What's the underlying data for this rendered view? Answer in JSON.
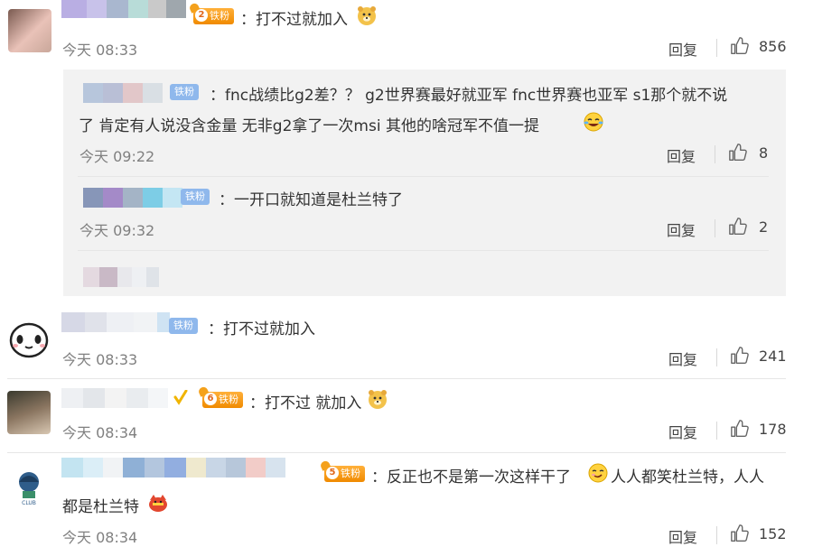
{
  "comments": [
    {
      "text": "：打不过就加入",
      "time": "今天 08:33",
      "reply_label": "回复",
      "likes": "856",
      "badge": {
        "level": "2",
        "label": "铁粉"
      }
    },
    {
      "text": "：打不过就加入",
      "time": "今天 08:33",
      "reply_label": "回复",
      "likes": "241",
      "badge": {
        "label": "铁粉"
      }
    },
    {
      "text": "：打不过 就加入",
      "time": "今天 08:34",
      "reply_label": "回复",
      "likes": "178",
      "badge": {
        "level": "6",
        "label": "铁粉"
      }
    },
    {
      "text_line1": "：反正也不是第一次这样干了",
      "text_line1b": "人人都笑杜兰特，人人",
      "text_line2": "都是杜兰特",
      "time": "今天 08:34",
      "reply_label": "回复",
      "likes": "152",
      "badge": {
        "level": "5",
        "label": "铁粉"
      }
    }
  ],
  "replies": [
    {
      "line1": "：fnc战绩比g2差？？  g2世界赛最好就亚军  fnc世界赛也亚军  s1那个就不说",
      "line2": "了  肯定有人说没含金量  无非g2拿了一次msi 其他的啥冠军不值一提",
      "time": "今天 09:22",
      "reply_label": "回复",
      "likes": "8",
      "badge": {
        "label": "铁粉"
      }
    },
    {
      "line1": "：一开口就知道是杜兰特了",
      "time": "今天 09:32",
      "reply_label": "回复",
      "likes": "2",
      "badge": {
        "label": "铁粉"
      }
    }
  ],
  "colors": {
    "badge_orange": "#f08a00",
    "badge_blue": "#8fb8ec",
    "nested_bg": "#f2f2f2"
  },
  "icons": [
    "thumb-up-icon",
    "doge-emoji-icon",
    "laugh-cry-emoji-icon",
    "smirk-emoji-icon",
    "red-face-emoji-icon",
    "verified-check-icon"
  ]
}
